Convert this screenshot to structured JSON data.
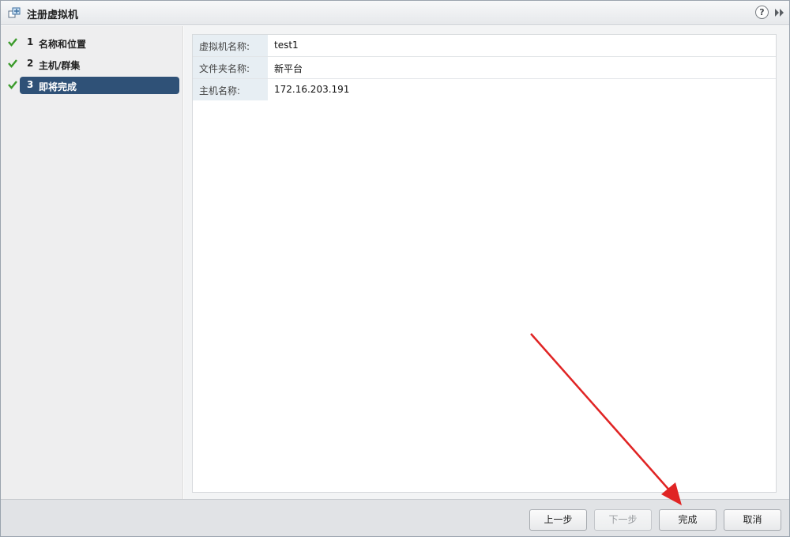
{
  "window": {
    "title": "注册虚拟机",
    "help_symbol": "?"
  },
  "steps": [
    {
      "number": "1",
      "label": "名称和位置",
      "completed": true,
      "active": false
    },
    {
      "number": "2",
      "label": "主机/群集",
      "completed": true,
      "active": false
    },
    {
      "number": "3",
      "label": "即将完成",
      "completed": true,
      "active": true
    }
  ],
  "summary": {
    "rows": [
      {
        "key": "虚拟机名称:",
        "value": "test1"
      },
      {
        "key": "文件夹名称:",
        "value": "新平台"
      },
      {
        "key": "主机名称:",
        "value": "172.16.203.191"
      }
    ]
  },
  "footer": {
    "back_label": "上一步",
    "next_label": "下一步",
    "finish_label": "完成",
    "cancel_label": "取消"
  },
  "colors": {
    "active_step": "#2f5177",
    "check": "#3a9a2a",
    "annotation_arrow": "#e02424"
  }
}
